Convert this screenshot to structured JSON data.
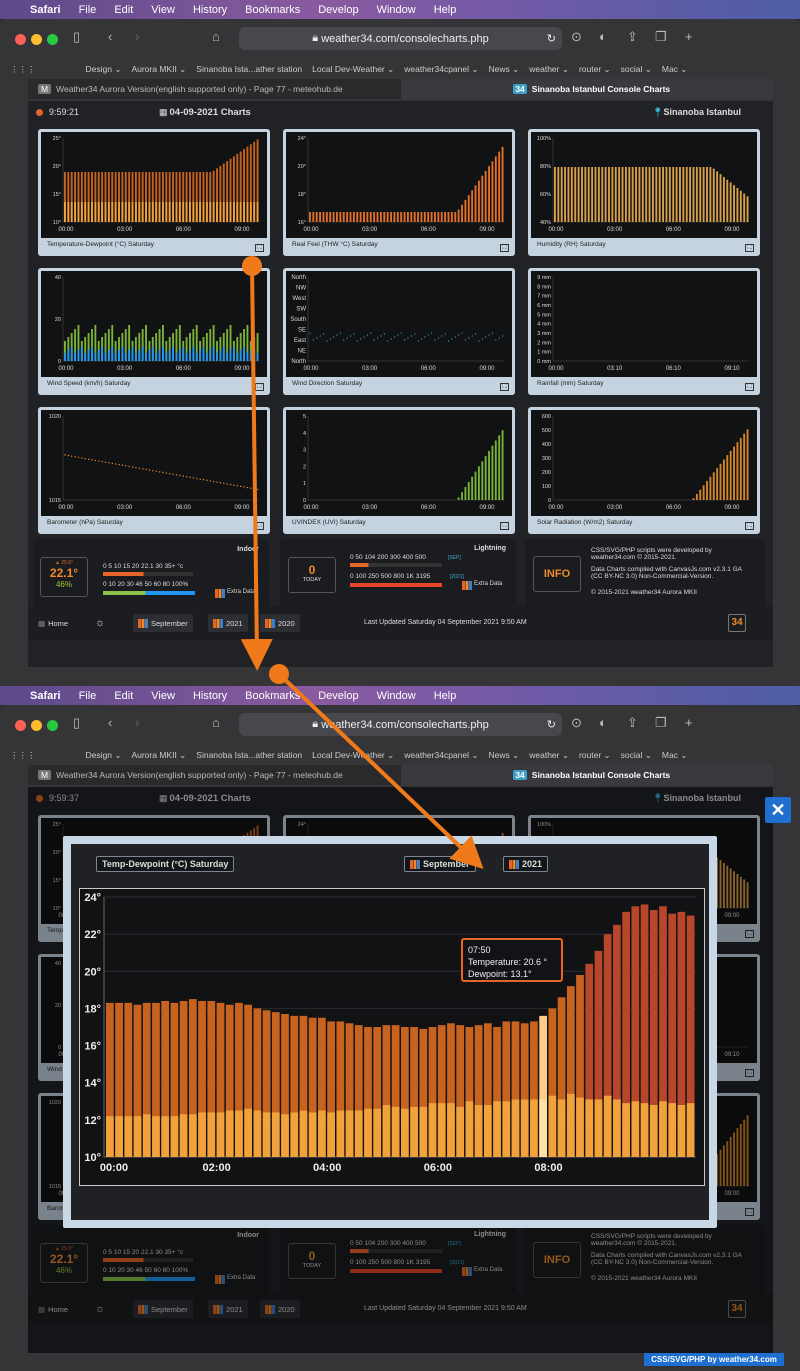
{
  "menubar": {
    "items": [
      "Safari",
      "File",
      "Edit",
      "View",
      "History",
      "Bookmarks",
      "Develop",
      "Window",
      "Help"
    ]
  },
  "browser": {
    "url": "weather34.com/consolecharts.php",
    "favorites": [
      "Design ⌄",
      "Aurora MKII ⌄",
      "Sinanoba Ista...ather station",
      "Local Dev-Weather ⌄",
      "weather34cpanel ⌄",
      "News ⌄",
      "weather ⌄",
      "router ⌄",
      "social ⌄",
      "Mac ⌄"
    ],
    "tab_inactive": "Weather34 Aurora Version(english supported only) - Page 77 - meteohub.de",
    "tab_active": "Sinanoba Istanbul Console Charts"
  },
  "page1": {
    "time": "9:59:21"
  },
  "page2": {
    "time": "9:59:37"
  },
  "header": {
    "date": "04-09-2021 Charts",
    "location": "Sinanoba Istanbul"
  },
  "cards": [
    {
      "label": "Temperature-Dewpoint (°C) Saturday",
      "yticks": [
        "25°",
        "20°",
        "15°",
        "10°"
      ],
      "xticks": [
        "00:00",
        "03:00",
        "06:00",
        "09:00"
      ]
    },
    {
      "label": "Real Feel (THW °C) Saturday",
      "yticks": [
        "24°",
        "20°",
        "18°",
        "16°"
      ],
      "xticks": [
        "00:00",
        "03:00",
        "06:00",
        "09:00"
      ]
    },
    {
      "label": "Humidity (RH) Saturday",
      "yticks": [
        "100%",
        "80%",
        "60%",
        "40%"
      ],
      "xticks": [
        "00:00",
        "03:00",
        "06:00",
        "09:00"
      ]
    },
    {
      "label": "Wind Speed (km/h) Saturday",
      "yticks": [
        "40",
        "20",
        "0"
      ],
      "xticks": [
        "00:00",
        "03:00",
        "06:00",
        "09:00"
      ]
    },
    {
      "label": "Wind Direction Saturday",
      "yticks": [
        "North",
        "NW",
        "West",
        "SW",
        "South",
        "SE",
        "East",
        "NE",
        "North"
      ],
      "xticks": [
        "00:00",
        "03:00",
        "06:00",
        "09:00"
      ]
    },
    {
      "label": "Rainfall (mm) Saturday",
      "yticks": [
        "9 mm",
        "8 mm",
        "7 mm",
        "6 mm",
        "5 mm",
        "4 mm",
        "3 mm",
        "2 mm",
        "1 mm",
        "0 mm"
      ],
      "xticks": [
        "00:00",
        "03:10",
        "06:10",
        "09:10"
      ]
    },
    {
      "label": "Barometer (hPa) Saturday",
      "yticks": [
        "1020",
        "1015"
      ],
      "xticks": [
        "00:00",
        "03:00",
        "06:00",
        "09:00"
      ]
    },
    {
      "label": "UVINDEX (UVI) Saturday",
      "yticks": [
        "5",
        "4",
        "3",
        "2",
        "1",
        "0"
      ],
      "xticks": [
        "00:00",
        "03:00",
        "06:00",
        "09:00"
      ]
    },
    {
      "label": "Solar Radiation (W/m2) Saturday",
      "yticks": [
        "600",
        "500",
        "400",
        "300",
        "200",
        "100",
        "0"
      ],
      "xticks": [
        "00:00",
        "03:00",
        "06:00",
        "09:00"
      ]
    }
  ],
  "indoor": {
    "title": "Indoor",
    "temp": "22.1°",
    "max": "▲ 25.6°",
    "humidity": "46%",
    "scale1": "0 5 10 15 20 22.1 30 35+ °c",
    "scale2": "0 10 20 30 46 50 60 80 100%",
    "extra": "Extra Data"
  },
  "lightning": {
    "title": "Lightning",
    "count": "0",
    "today": "TODAY",
    "scale1": "0 50 104 200 300 400 500",
    "scale2": "0 100 250 500 800 1K 3195",
    "tag1": "[SEP]",
    "tag2": "[2021]",
    "extra": "Extra Data"
  },
  "infobox": {
    "btn": "INFO",
    "line1": "CSS/SVG/PHP scripts were developed by weather34.com © 2015-2021.",
    "line2": "Data Charts compiled with CanvasJs.com v2.3.1 GA (CC BY-NC 3.0) Non-Commercial-Version.",
    "line3": "© 2015-2021 weather34 Aurora MKII"
  },
  "nav": {
    "home": "Home",
    "september": "September",
    "y2021": "2021",
    "y2020": "2020",
    "updated": "Last Updated Saturday 04 September 2021 9:50 AM",
    "logo": "34"
  },
  "modal": {
    "title": "Temp-Dewpoint (°C) Saturday",
    "btn_month": "September",
    "btn_year": "2021",
    "tooltip_time": "07:50",
    "tooltip_temp": "Temperature:  20.6 °",
    "tooltip_dew": "Dewpoint:  13.1°"
  },
  "footer": {
    "credit": "CSS/SVG/PHP by weather34.com"
  },
  "colors": {
    "temp": "#c8631f",
    "dew": "#f2a23a",
    "hot": "#c44a2a",
    "accent": "#e8652a",
    "blue": "#1e6fcf"
  },
  "chart_data": {
    "type": "bar",
    "title": "Temp-Dewpoint (°C) Saturday",
    "xlabel": "",
    "ylabel": "",
    "ylim": [
      10,
      24
    ],
    "x_ticks": [
      "00:00",
      "02:00",
      "04:00",
      "06:00",
      "08:00"
    ],
    "y_ticks": [
      "24°",
      "22°",
      "20°",
      "18°",
      "16°",
      "14°",
      "12°",
      "10°"
    ],
    "x": [
      "00:00",
      "00:10",
      "00:20",
      "00:30",
      "00:40",
      "00:50",
      "01:00",
      "01:10",
      "01:20",
      "01:30",
      "01:40",
      "01:50",
      "02:00",
      "02:10",
      "02:20",
      "02:30",
      "02:40",
      "02:50",
      "03:00",
      "03:10",
      "03:20",
      "03:30",
      "03:40",
      "03:50",
      "04:00",
      "04:10",
      "04:20",
      "04:30",
      "04:40",
      "04:50",
      "05:00",
      "05:10",
      "05:20",
      "05:30",
      "05:40",
      "05:50",
      "06:00",
      "06:10",
      "06:20",
      "06:30",
      "06:40",
      "06:50",
      "07:00",
      "07:10",
      "07:20",
      "07:30",
      "07:40",
      "07:50",
      "08:00",
      "08:10",
      "08:20",
      "08:30",
      "08:40",
      "08:50",
      "09:00",
      "09:10",
      "09:20",
      "09:30",
      "09:40",
      "09:50"
    ],
    "series": [
      {
        "name": "Temperature",
        "values": [
          18.3,
          18.3,
          18.3,
          18.2,
          18.3,
          18.3,
          18.4,
          18.3,
          18.4,
          18.5,
          18.4,
          18.4,
          18.3,
          18.2,
          18.3,
          18.2,
          18.0,
          17.9,
          17.8,
          17.7,
          17.6,
          17.6,
          17.5,
          17.5,
          17.3,
          17.3,
          17.2,
          17.1,
          17.0,
          17.0,
          17.1,
          17.1,
          17.0,
          17.0,
          16.9,
          17.0,
          17.1,
          17.2,
          17.1,
          17.0,
          17.1,
          17.2,
          17.0,
          17.3,
          17.3,
          17.2,
          17.3,
          17.6,
          18.0,
          18.6,
          19.2,
          19.8,
          20.4,
          21.1,
          22.0,
          22.5,
          23.2,
          23.5,
          23.6,
          23.3,
          23.5,
          23.1,
          23.2,
          23.0
        ],
        "color": "#c8631f"
      },
      {
        "name": "Dewpoint",
        "values": [
          12.2,
          12.2,
          12.2,
          12.2,
          12.3,
          12.2,
          12.2,
          12.2,
          12.3,
          12.3,
          12.4,
          12.4,
          12.4,
          12.5,
          12.5,
          12.6,
          12.5,
          12.4,
          12.4,
          12.3,
          12.4,
          12.5,
          12.4,
          12.5,
          12.4,
          12.5,
          12.5,
          12.5,
          12.6,
          12.6,
          12.8,
          12.7,
          12.6,
          12.7,
          12.7,
          12.9,
          12.9,
          12.9,
          12.7,
          13.0,
          12.8,
          12.8,
          13.0,
          13.0,
          13.1,
          13.1,
          13.1,
          13.1,
          13.3,
          13.1,
          13.4,
          13.2,
          13.1,
          13.1,
          13.3,
          13.1,
          12.9,
          13.0,
          12.9,
          12.8,
          13.0,
          12.9,
          12.8,
          12.9
        ],
        "color": "#f2a23a"
      }
    ]
  }
}
